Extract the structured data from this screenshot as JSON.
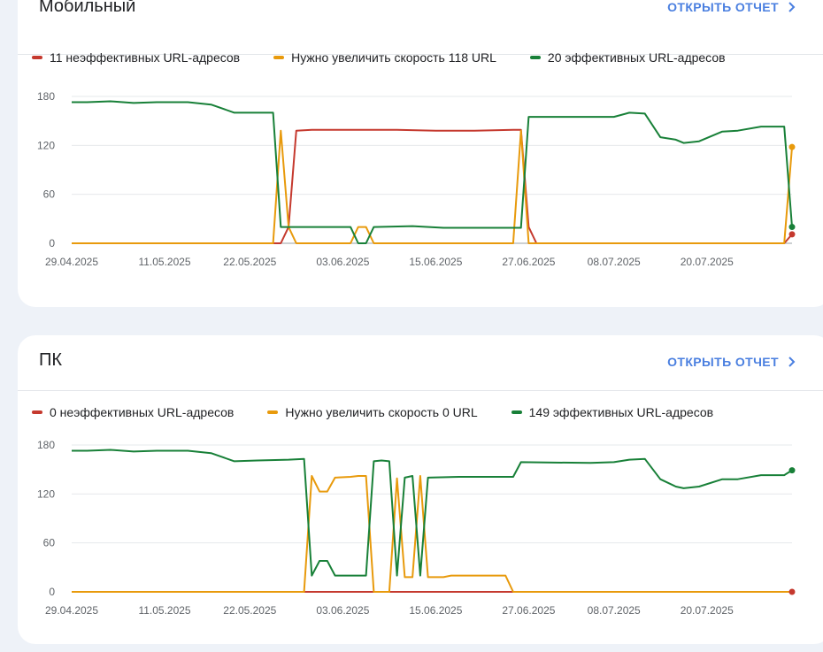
{
  "cards": [
    {
      "title": "Мобильный",
      "open_report": "ОТКРЫТЬ ОТЧЕТ",
      "legend": [
        {
          "label": "11 неэффективных URL-адресов",
          "color": "#c5392e"
        },
        {
          "label": "Нужно увеличить скорость 118 URL",
          "color": "#e89a0c"
        },
        {
          "label": "20 эффективных URL-адресов",
          "color": "#188038"
        }
      ]
    },
    {
      "title": "ПК",
      "open_report": "ОТКРЫТЬ ОТЧЕТ",
      "legend": [
        {
          "label": "0 неэффективных URL-адресов",
          "color": "#c5392e"
        },
        {
          "label": "Нужно увеличить скорость 0 URL",
          "color": "#e89a0c"
        },
        {
          "label": "149 эффективных URL-адресов",
          "color": "#188038"
        }
      ]
    }
  ],
  "chart_data": [
    {
      "type": "line",
      "title": "Мобильный",
      "x_range": [
        "2025-04-29",
        "2025-07-31"
      ],
      "x_ticks": [
        "29.04.2025",
        "11.05.2025",
        "22.05.2025",
        "03.06.2025",
        "15.06.2025",
        "27.06.2025",
        "08.07.2025",
        "20.07.2025"
      ],
      "y_ticks": [
        0,
        60,
        120,
        180
      ],
      "ylim": [
        0,
        180
      ],
      "grid": true,
      "series": [
        {
          "name": "11 неэффективных URL-адресов",
          "color": "#c5392e",
          "end_marker": true,
          "points": [
            [
              "2025-04-29",
              0
            ],
            [
              "2025-05-26",
              0
            ],
            [
              "2025-05-27",
              20
            ],
            [
              "2025-05-28",
              138
            ],
            [
              "2025-05-30",
              139
            ],
            [
              "2025-06-05",
              139
            ],
            [
              "2025-06-10",
              139
            ],
            [
              "2025-06-15",
              138
            ],
            [
              "2025-06-20",
              138
            ],
            [
              "2025-06-25",
              139
            ],
            [
              "2025-06-26",
              139
            ],
            [
              "2025-06-27",
              20
            ],
            [
              "2025-06-28",
              0
            ],
            [
              "2025-07-30",
              0
            ],
            [
              "2025-07-31",
              11
            ]
          ]
        },
        {
          "name": "Нужно увеличить скорость 118 URL",
          "color": "#e89a0c",
          "end_marker": true,
          "points": [
            [
              "2025-04-29",
              0
            ],
            [
              "2025-05-25",
              0
            ],
            [
              "2025-05-26",
              138
            ],
            [
              "2025-05-27",
              20
            ],
            [
              "2025-05-28",
              0
            ],
            [
              "2025-06-04",
              0
            ],
            [
              "2025-06-05",
              20
            ],
            [
              "2025-06-06",
              20
            ],
            [
              "2025-06-07",
              0
            ],
            [
              "2025-06-25",
              0
            ],
            [
              "2025-06-26",
              138
            ],
            [
              "2025-06-27",
              0
            ],
            [
              "2025-07-30",
              0
            ],
            [
              "2025-07-31",
              118
            ]
          ]
        },
        {
          "name": "20 эффективных URL-адресов",
          "color": "#188038",
          "end_marker": true,
          "points": [
            [
              "2025-04-29",
              173
            ],
            [
              "2025-05-01",
              173
            ],
            [
              "2025-05-04",
              174
            ],
            [
              "2025-05-07",
              172
            ],
            [
              "2025-05-10",
              173
            ],
            [
              "2025-05-14",
              173
            ],
            [
              "2025-05-17",
              170
            ],
            [
              "2025-05-20",
              160
            ],
            [
              "2025-05-25",
              160
            ],
            [
              "2025-05-26",
              20
            ],
            [
              "2025-05-28",
              20
            ],
            [
              "2025-06-01",
              20
            ],
            [
              "2025-06-04",
              20
            ],
            [
              "2025-06-05",
              0
            ],
            [
              "2025-06-06",
              0
            ],
            [
              "2025-06-07",
              20
            ],
            [
              "2025-06-12",
              21
            ],
            [
              "2025-06-16",
              19
            ],
            [
              "2025-06-20",
              19
            ],
            [
              "2025-06-25",
              19
            ],
            [
              "2025-06-26",
              19
            ],
            [
              "2025-06-27",
              155
            ],
            [
              "2025-07-05",
              155
            ],
            [
              "2025-07-08",
              155
            ],
            [
              "2025-07-10",
              160
            ],
            [
              "2025-07-12",
              159
            ],
            [
              "2025-07-14",
              130
            ],
            [
              "2025-07-16",
              127
            ],
            [
              "2025-07-17",
              123
            ],
            [
              "2025-07-19",
              125
            ],
            [
              "2025-07-22",
              137
            ],
            [
              "2025-07-24",
              138
            ],
            [
              "2025-07-27",
              143
            ],
            [
              "2025-07-30",
              143
            ],
            [
              "2025-07-31",
              20
            ]
          ]
        }
      ]
    },
    {
      "type": "line",
      "title": "ПК",
      "x_range": [
        "2025-04-29",
        "2025-07-31"
      ],
      "x_ticks": [
        "29.04.2025",
        "11.05.2025",
        "22.05.2025",
        "03.06.2025",
        "15.06.2025",
        "27.06.2025",
        "08.07.2025",
        "20.07.2025"
      ],
      "y_ticks": [
        0,
        60,
        120,
        180
      ],
      "ylim": [
        0,
        180
      ],
      "grid": true,
      "series": [
        {
          "name": "0 неэффективных URL-адресов",
          "color": "#c5392e",
          "end_marker": true,
          "points": [
            [
              "2025-04-29",
              0
            ],
            [
              "2025-07-31",
              0
            ]
          ]
        },
        {
          "name": "Нужно увеличить скорость 0 URL",
          "color": "#e89a0c",
          "end_marker": false,
          "points": [
            [
              "2025-04-29",
              0
            ],
            [
              "2025-05-29",
              0
            ],
            [
              "2025-05-30",
              142
            ],
            [
              "2025-05-31",
              123
            ],
            [
              "2025-06-01",
              123
            ],
            [
              "2025-06-02",
              140
            ],
            [
              "2025-06-04",
              141
            ],
            [
              "2025-06-05",
              142
            ],
            [
              "2025-06-06",
              142
            ],
            [
              "2025-06-07",
              0
            ],
            [
              "2025-06-09",
              0
            ],
            [
              "2025-06-10",
              139
            ],
            [
              "2025-06-11",
              18
            ],
            [
              "2025-06-12",
              18
            ],
            [
              "2025-06-13",
              142
            ],
            [
              "2025-06-14",
              18
            ],
            [
              "2025-06-16",
              18
            ],
            [
              "2025-06-17",
              20
            ],
            [
              "2025-06-24",
              20
            ],
            [
              "2025-06-25",
              0
            ],
            [
              "2025-07-31",
              0
            ]
          ]
        },
        {
          "name": "149 эффективных URL-адресов",
          "color": "#188038",
          "end_marker": true,
          "points": [
            [
              "2025-04-29",
              173
            ],
            [
              "2025-05-01",
              173
            ],
            [
              "2025-05-04",
              174
            ],
            [
              "2025-05-07",
              172
            ],
            [
              "2025-05-10",
              173
            ],
            [
              "2025-05-14",
              173
            ],
            [
              "2025-05-17",
              170
            ],
            [
              "2025-05-20",
              160
            ],
            [
              "2025-05-23",
              161
            ],
            [
              "2025-05-27",
              162
            ],
            [
              "2025-05-29",
              163
            ],
            [
              "2025-05-30",
              20
            ],
            [
              "2025-05-31",
              38
            ],
            [
              "2025-06-01",
              38
            ],
            [
              "2025-06-02",
              20
            ],
            [
              "2025-06-06",
              20
            ],
            [
              "2025-06-07",
              160
            ],
            [
              "2025-06-08",
              161
            ],
            [
              "2025-06-09",
              160
            ],
            [
              "2025-06-10",
              20
            ],
            [
              "2025-06-11",
              140
            ],
            [
              "2025-06-12",
              142
            ],
            [
              "2025-06-13",
              20
            ],
            [
              "2025-06-14",
              140
            ],
            [
              "2025-06-18",
              141
            ],
            [
              "2025-06-25",
              141
            ],
            [
              "2025-06-26",
              159
            ],
            [
              "2025-07-05",
              158
            ],
            [
              "2025-07-08",
              159
            ],
            [
              "2025-07-10",
              162
            ],
            [
              "2025-07-12",
              163
            ],
            [
              "2025-07-14",
              138
            ],
            [
              "2025-07-16",
              129
            ],
            [
              "2025-07-17",
              127
            ],
            [
              "2025-07-19",
              129
            ],
            [
              "2025-07-22",
              138
            ],
            [
              "2025-07-24",
              138
            ],
            [
              "2025-07-27",
              143
            ],
            [
              "2025-07-30",
              143
            ],
            [
              "2025-07-31",
              149
            ]
          ]
        }
      ]
    }
  ]
}
